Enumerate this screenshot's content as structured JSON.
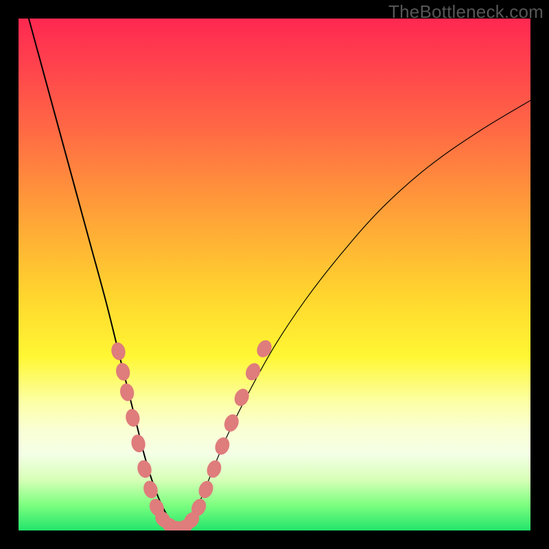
{
  "watermark": "TheBottleneck.com",
  "colors": {
    "background": "#000000",
    "gradient_top": "#ff2850",
    "gradient_bottom": "#22e56b",
    "curve": "#000000",
    "marker": "#df7c7c"
  },
  "chart_data": {
    "type": "line",
    "title": "",
    "xlabel": "",
    "ylabel": "",
    "xlim": [
      0,
      100
    ],
    "ylim": [
      0,
      100
    ],
    "grid": false,
    "series": [
      {
        "name": "bottleneck-curve",
        "x": [
          2,
          5,
          8,
          11,
          14,
          17,
          19.5,
          21.5,
          23,
          24.5,
          26,
          27.5,
          29,
          30,
          31,
          32,
          33,
          34,
          36,
          38,
          41,
          45,
          50,
          56,
          63,
          71,
          80,
          90,
          100
        ],
        "values": [
          100,
          89,
          78,
          67,
          56,
          45,
          35,
          27,
          21,
          15,
          10,
          6,
          3,
          1.5,
          0.6,
          0.5,
          1.2,
          3,
          7,
          12,
          19,
          27,
          36,
          45,
          54,
          63,
          71,
          78,
          84
        ]
      }
    ],
    "markers": {
      "name": "highlighted-points",
      "points": [
        {
          "x": 19.5,
          "y": 35
        },
        {
          "x": 20.4,
          "y": 31
        },
        {
          "x": 21.2,
          "y": 27
        },
        {
          "x": 22.3,
          "y": 22
        },
        {
          "x": 23.4,
          "y": 17
        },
        {
          "x": 24.6,
          "y": 12
        },
        {
          "x": 25.8,
          "y": 8
        },
        {
          "x": 27.0,
          "y": 4.5
        },
        {
          "x": 28.2,
          "y": 2.2
        },
        {
          "x": 29.6,
          "y": 1.0
        },
        {
          "x": 31.0,
          "y": 0.5
        },
        {
          "x": 32.4,
          "y": 0.7
        },
        {
          "x": 33.8,
          "y": 2.0
        },
        {
          "x": 35.2,
          "y": 4.5
        },
        {
          "x": 36.6,
          "y": 8
        },
        {
          "x": 38.2,
          "y": 12
        },
        {
          "x": 39.8,
          "y": 16.5
        },
        {
          "x": 41.6,
          "y": 21
        },
        {
          "x": 43.6,
          "y": 26
        },
        {
          "x": 45.8,
          "y": 31
        },
        {
          "x": 48.0,
          "y": 35.5
        }
      ]
    }
  }
}
